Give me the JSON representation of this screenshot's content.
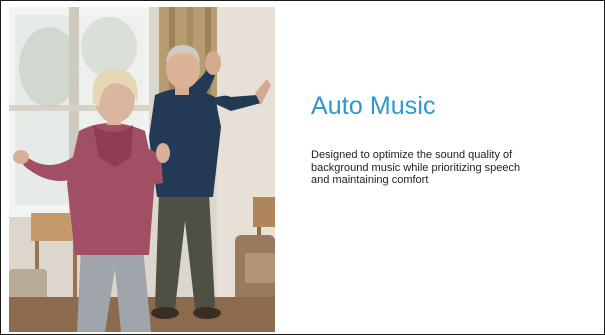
{
  "slide": {
    "title": "Auto Music",
    "description": "Designed to optimize the sound quality of background music while prioritizing speech and maintaining comfort"
  },
  "photo": {
    "subject": "older-couple-dancing",
    "palette": {
      "window": "#eef0ee",
      "wall": "#e3ddd5",
      "curtain": "#b69c70",
      "woman_shirt": "#a04f64",
      "woman_pants": "#9fa5aa",
      "man_sweater": "#223a56",
      "man_pants": "#4f5044",
      "floor": "#8c6b4c",
      "sofa": "#9a7a5e"
    }
  },
  "colors": {
    "title": "#2e96d4",
    "body_text": "#1f1f1f",
    "border": "#1a1a1a"
  }
}
